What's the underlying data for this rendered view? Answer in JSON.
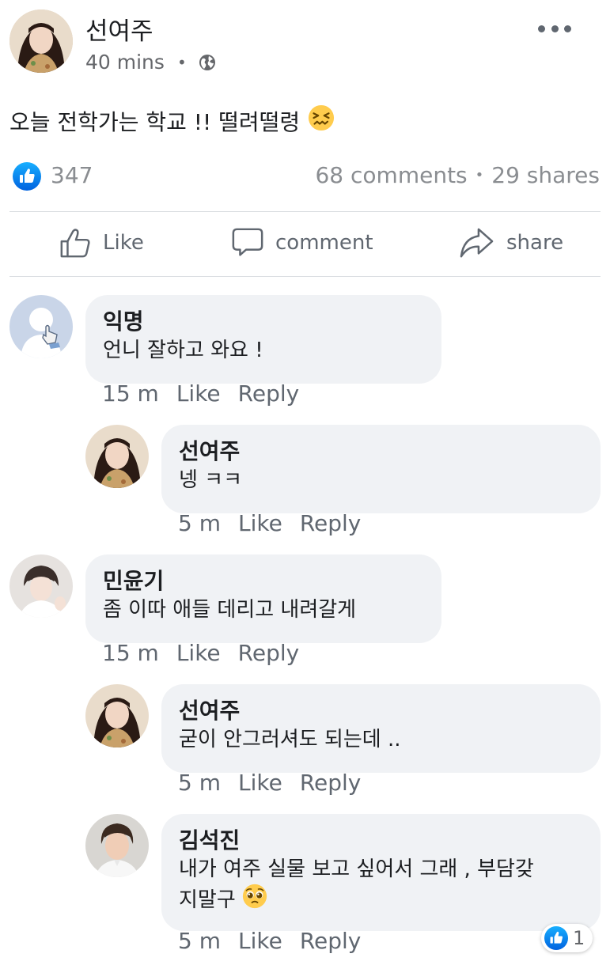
{
  "post": {
    "author": "선여주",
    "time": "40 mins",
    "privacy_icon": "globe-icon",
    "text": "오늘 전학가는 학교 !! 떨려떨령",
    "emoji": "confounded-face-emoji",
    "likes": "347",
    "comments_count": "68 comments",
    "shares_count": "29 shares"
  },
  "actions": {
    "like": "Like",
    "comment": "comment",
    "share": "share"
  },
  "comments": [
    {
      "name": "익명",
      "text": "언니 잘하고 와요 !",
      "time": "15 m",
      "like": "Like",
      "reply": "Reply"
    },
    {
      "name": "선여주",
      "text": "넹 ㅋㅋ",
      "time": "5 m",
      "like": "Like",
      "reply": "Reply"
    },
    {
      "name": "민윤기",
      "text": "좀 이따 애들 데리고 내려갈게",
      "time": "15 m",
      "like": "Like",
      "reply": "Reply"
    },
    {
      "name": "선여주",
      "text": "굳이 안그러셔도 되는데 ..",
      "time": "5 m",
      "like": "Like",
      "reply": "Reply"
    },
    {
      "name": "김석진",
      "text": "내가 여주 실물 보고 싶어서 그래 , 부담갖",
      "text2": "지말구",
      "emoji": "pleading-face-emoji",
      "time": "5 m",
      "like": "Like",
      "reply": "Reply",
      "reactions": "1"
    }
  ],
  "colors": {
    "accent": "#1877f2",
    "bubble": "#f0f2f5",
    "muted": "#65676b"
  }
}
